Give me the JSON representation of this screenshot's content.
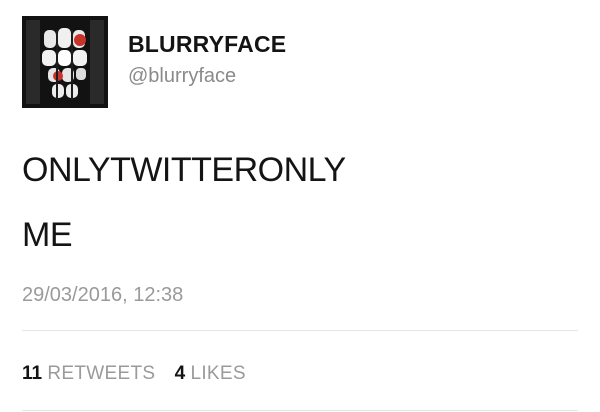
{
  "profile": {
    "display_name": "BLURRYFACE",
    "handle": "@blurryface",
    "avatar_icon": "skull-hands-avatar"
  },
  "tweet": {
    "lines": [
      "ONLYTWITTERONLY",
      "ME"
    ],
    "timestamp": "29/03/2016, 12:38"
  },
  "stats": {
    "retweets_count": "11",
    "retweets_label": "RETWEETS",
    "likes_count": "4",
    "likes_label": "LIKES"
  },
  "colors": {
    "text": "#141414",
    "muted": "#9a9a9a",
    "divider": "#e6e6e6",
    "avatar_accent": "#c8322a"
  }
}
